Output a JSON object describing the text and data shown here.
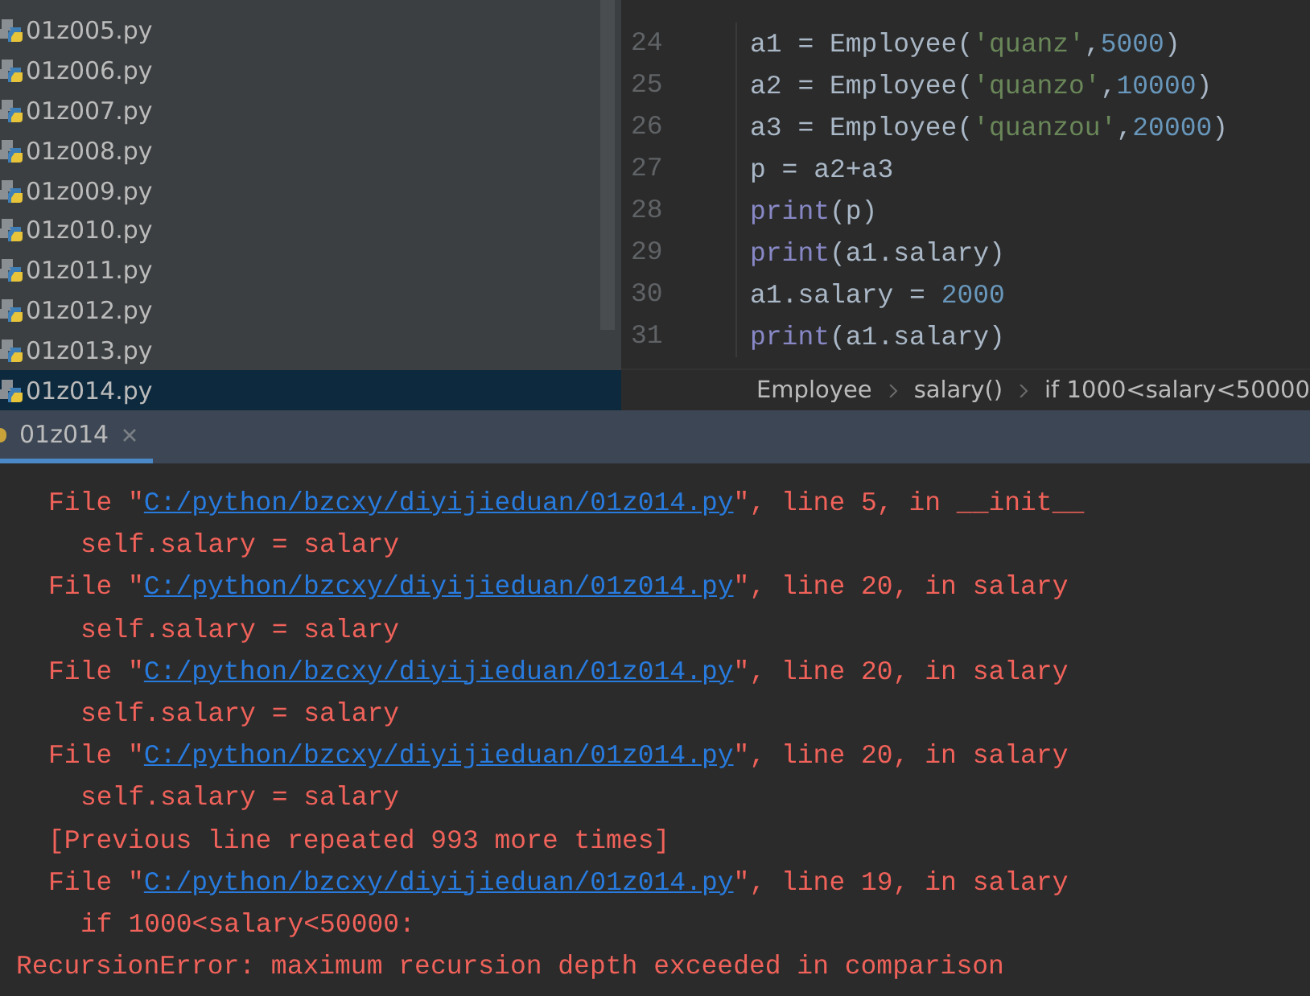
{
  "project_files": [
    {
      "name": "01z005.py",
      "selected": false
    },
    {
      "name": "01z006.py",
      "selected": false
    },
    {
      "name": "01z007.py",
      "selected": false
    },
    {
      "name": "01z008.py",
      "selected": false
    },
    {
      "name": "01z009.py",
      "selected": false
    },
    {
      "name": "01z010.py",
      "selected": false
    },
    {
      "name": "01z011.py",
      "selected": false
    },
    {
      "name": "01z012.py",
      "selected": false
    },
    {
      "name": "01z013.py",
      "selected": false
    },
    {
      "name": "01z014.py",
      "selected": true
    }
  ],
  "editor": {
    "lines": [
      {
        "number": "24",
        "tokens": [
          {
            "kind": "plain",
            "text": "a1 = Employee("
          },
          {
            "kind": "string",
            "text": "'quanz'"
          },
          {
            "kind": "plain",
            "text": ","
          },
          {
            "kind": "number",
            "text": "5000"
          },
          {
            "kind": "plain",
            "text": ")"
          }
        ]
      },
      {
        "number": "25",
        "tokens": [
          {
            "kind": "plain",
            "text": "a2 = Employee("
          },
          {
            "kind": "string",
            "text": "'quanzo'"
          },
          {
            "kind": "plain",
            "text": ","
          },
          {
            "kind": "number",
            "text": "10000"
          },
          {
            "kind": "plain",
            "text": ")"
          }
        ]
      },
      {
        "number": "26",
        "tokens": [
          {
            "kind": "plain",
            "text": "a3 = Employee("
          },
          {
            "kind": "string",
            "text": "'quanzou'"
          },
          {
            "kind": "plain",
            "text": ","
          },
          {
            "kind": "number",
            "text": "20000"
          },
          {
            "kind": "plain",
            "text": ")"
          }
        ]
      },
      {
        "number": "27",
        "tokens": [
          {
            "kind": "plain",
            "text": "p = a2+a3"
          }
        ]
      },
      {
        "number": "28",
        "tokens": [
          {
            "kind": "builtin",
            "text": "print"
          },
          {
            "kind": "plain",
            "text": "(p)"
          }
        ]
      },
      {
        "number": "29",
        "tokens": [
          {
            "kind": "builtin",
            "text": "print"
          },
          {
            "kind": "plain",
            "text": "(a1.salary)"
          }
        ]
      },
      {
        "number": "30",
        "tokens": [
          {
            "kind": "plain",
            "text": "a1.salary = "
          },
          {
            "kind": "number",
            "text": "2000"
          }
        ]
      },
      {
        "number": "31",
        "tokens": [
          {
            "kind": "builtin",
            "text": "print"
          },
          {
            "kind": "plain",
            "text": "(a1.salary)"
          }
        ]
      }
    ],
    "breadcrumbs": [
      "Employee",
      "salary()",
      "if 1000<salary<50000"
    ]
  },
  "run_tab": {
    "label": "01z014",
    "selected": true
  },
  "console": [
    {
      "kind": "frame",
      "before": "File \"",
      "link": "C:/python/bzcxy/diyijieduan/01z014.py",
      "after": "\", line 5, in __init__"
    },
    {
      "kind": "code",
      "text": "self.salary = salary"
    },
    {
      "kind": "frame",
      "before": "File \"",
      "link": "C:/python/bzcxy/diyijieduan/01z014.py",
      "after": "\", line 20, in salary"
    },
    {
      "kind": "code",
      "text": "self.salary = salary"
    },
    {
      "kind": "frame",
      "before": "File \"",
      "link": "C:/python/bzcxy/diyijieduan/01z014.py",
      "after": "\", line 20, in salary"
    },
    {
      "kind": "code",
      "text": "self.salary = salary"
    },
    {
      "kind": "frame",
      "before": "File \"",
      "link": "C:/python/bzcxy/diyijieduan/01z014.py",
      "after": "\", line 20, in salary"
    },
    {
      "kind": "code",
      "text": "self.salary = salary"
    },
    {
      "kind": "note",
      "text": "[Previous line repeated 993 more times]"
    },
    {
      "kind": "frame",
      "before": "File \"",
      "link": "C:/python/bzcxy/diyijieduan/01z014.py",
      "after": "\", line 19, in salary"
    },
    {
      "kind": "code",
      "text": "if 1000<salary<50000:"
    },
    {
      "kind": "error",
      "text": "RecursionError: maximum recursion depth exceeded in comparison"
    }
  ]
}
